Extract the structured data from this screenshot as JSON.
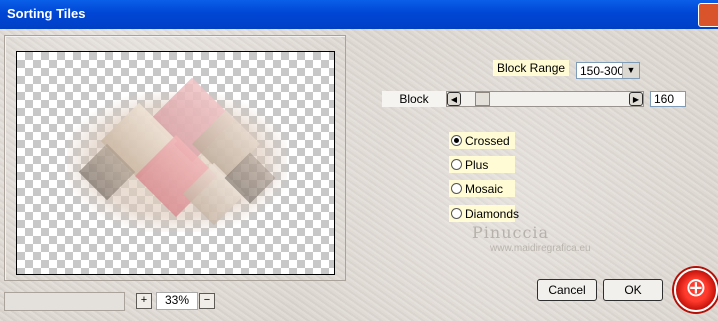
{
  "window": {
    "title": "Sorting Tiles"
  },
  "controls": {
    "block_range_label": "Block Range",
    "block_range_value": "150-300",
    "block_label": "Block",
    "block_value": "160",
    "block_slider_level": 0.15
  },
  "radios": [
    {
      "label": "Crossed",
      "checked": true
    },
    {
      "label": "Plus",
      "checked": false
    },
    {
      "label": "Mosaic",
      "checked": false
    },
    {
      "label": "Diamonds",
      "checked": false
    }
  ],
  "watermark": {
    "text": "Pinuccia",
    "url": "www.maidiregrafica.eu"
  },
  "zoom": {
    "plus": "+",
    "minus": "−",
    "value": "33%"
  },
  "buttons": {
    "cancel": "Cancel",
    "ok": "OK"
  },
  "icons": {
    "close": "close-icon",
    "plus": "plus-icon",
    "minus": "minus-icon",
    "slider_left": "arrow-left-icon",
    "slider_right": "arrow-right-icon",
    "dropdown": "chevron-down-icon",
    "logo": "app-logo-icon"
  }
}
